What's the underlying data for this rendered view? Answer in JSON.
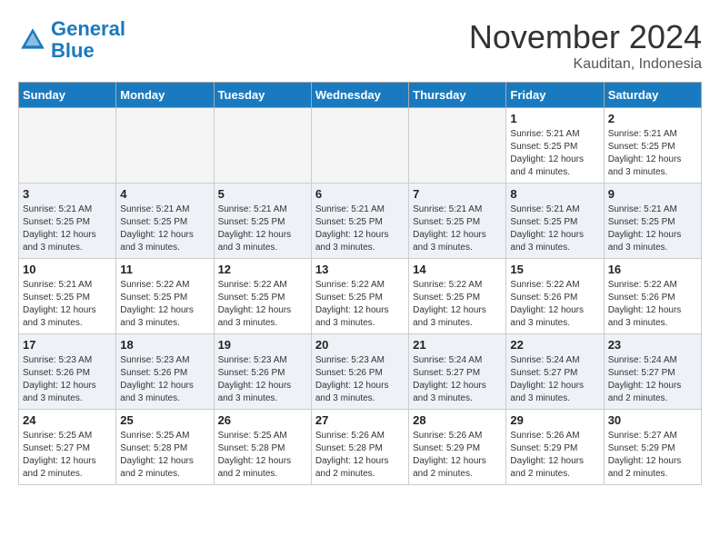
{
  "header": {
    "logo_line1": "General",
    "logo_line2": "Blue",
    "month": "November 2024",
    "location": "Kauditan, Indonesia"
  },
  "weekdays": [
    "Sunday",
    "Monday",
    "Tuesday",
    "Wednesday",
    "Thursday",
    "Friday",
    "Saturday"
  ],
  "weeks": [
    [
      {
        "day": "",
        "info": ""
      },
      {
        "day": "",
        "info": ""
      },
      {
        "day": "",
        "info": ""
      },
      {
        "day": "",
        "info": ""
      },
      {
        "day": "",
        "info": ""
      },
      {
        "day": "1",
        "info": "Sunrise: 5:21 AM\nSunset: 5:25 PM\nDaylight: 12 hours\nand 4 minutes."
      },
      {
        "day": "2",
        "info": "Sunrise: 5:21 AM\nSunset: 5:25 PM\nDaylight: 12 hours\nand 3 minutes."
      }
    ],
    [
      {
        "day": "3",
        "info": "Sunrise: 5:21 AM\nSunset: 5:25 PM\nDaylight: 12 hours\nand 3 minutes."
      },
      {
        "day": "4",
        "info": "Sunrise: 5:21 AM\nSunset: 5:25 PM\nDaylight: 12 hours\nand 3 minutes."
      },
      {
        "day": "5",
        "info": "Sunrise: 5:21 AM\nSunset: 5:25 PM\nDaylight: 12 hours\nand 3 minutes."
      },
      {
        "day": "6",
        "info": "Sunrise: 5:21 AM\nSunset: 5:25 PM\nDaylight: 12 hours\nand 3 minutes."
      },
      {
        "day": "7",
        "info": "Sunrise: 5:21 AM\nSunset: 5:25 PM\nDaylight: 12 hours\nand 3 minutes."
      },
      {
        "day": "8",
        "info": "Sunrise: 5:21 AM\nSunset: 5:25 PM\nDaylight: 12 hours\nand 3 minutes."
      },
      {
        "day": "9",
        "info": "Sunrise: 5:21 AM\nSunset: 5:25 PM\nDaylight: 12 hours\nand 3 minutes."
      }
    ],
    [
      {
        "day": "10",
        "info": "Sunrise: 5:21 AM\nSunset: 5:25 PM\nDaylight: 12 hours\nand 3 minutes."
      },
      {
        "day": "11",
        "info": "Sunrise: 5:22 AM\nSunset: 5:25 PM\nDaylight: 12 hours\nand 3 minutes."
      },
      {
        "day": "12",
        "info": "Sunrise: 5:22 AM\nSunset: 5:25 PM\nDaylight: 12 hours\nand 3 minutes."
      },
      {
        "day": "13",
        "info": "Sunrise: 5:22 AM\nSunset: 5:25 PM\nDaylight: 12 hours\nand 3 minutes."
      },
      {
        "day": "14",
        "info": "Sunrise: 5:22 AM\nSunset: 5:25 PM\nDaylight: 12 hours\nand 3 minutes."
      },
      {
        "day": "15",
        "info": "Sunrise: 5:22 AM\nSunset: 5:26 PM\nDaylight: 12 hours\nand 3 minutes."
      },
      {
        "day": "16",
        "info": "Sunrise: 5:22 AM\nSunset: 5:26 PM\nDaylight: 12 hours\nand 3 minutes."
      }
    ],
    [
      {
        "day": "17",
        "info": "Sunrise: 5:23 AM\nSunset: 5:26 PM\nDaylight: 12 hours\nand 3 minutes."
      },
      {
        "day": "18",
        "info": "Sunrise: 5:23 AM\nSunset: 5:26 PM\nDaylight: 12 hours\nand 3 minutes."
      },
      {
        "day": "19",
        "info": "Sunrise: 5:23 AM\nSunset: 5:26 PM\nDaylight: 12 hours\nand 3 minutes."
      },
      {
        "day": "20",
        "info": "Sunrise: 5:23 AM\nSunset: 5:26 PM\nDaylight: 12 hours\nand 3 minutes."
      },
      {
        "day": "21",
        "info": "Sunrise: 5:24 AM\nSunset: 5:27 PM\nDaylight: 12 hours\nand 3 minutes."
      },
      {
        "day": "22",
        "info": "Sunrise: 5:24 AM\nSunset: 5:27 PM\nDaylight: 12 hours\nand 3 minutes."
      },
      {
        "day": "23",
        "info": "Sunrise: 5:24 AM\nSunset: 5:27 PM\nDaylight: 12 hours\nand 2 minutes."
      }
    ],
    [
      {
        "day": "24",
        "info": "Sunrise: 5:25 AM\nSunset: 5:27 PM\nDaylight: 12 hours\nand 2 minutes."
      },
      {
        "day": "25",
        "info": "Sunrise: 5:25 AM\nSunset: 5:28 PM\nDaylight: 12 hours\nand 2 minutes."
      },
      {
        "day": "26",
        "info": "Sunrise: 5:25 AM\nSunset: 5:28 PM\nDaylight: 12 hours\nand 2 minutes."
      },
      {
        "day": "27",
        "info": "Sunrise: 5:26 AM\nSunset: 5:28 PM\nDaylight: 12 hours\nand 2 minutes."
      },
      {
        "day": "28",
        "info": "Sunrise: 5:26 AM\nSunset: 5:29 PM\nDaylight: 12 hours\nand 2 minutes."
      },
      {
        "day": "29",
        "info": "Sunrise: 5:26 AM\nSunset: 5:29 PM\nDaylight: 12 hours\nand 2 minutes."
      },
      {
        "day": "30",
        "info": "Sunrise: 5:27 AM\nSunset: 5:29 PM\nDaylight: 12 hours\nand 2 minutes."
      }
    ]
  ]
}
